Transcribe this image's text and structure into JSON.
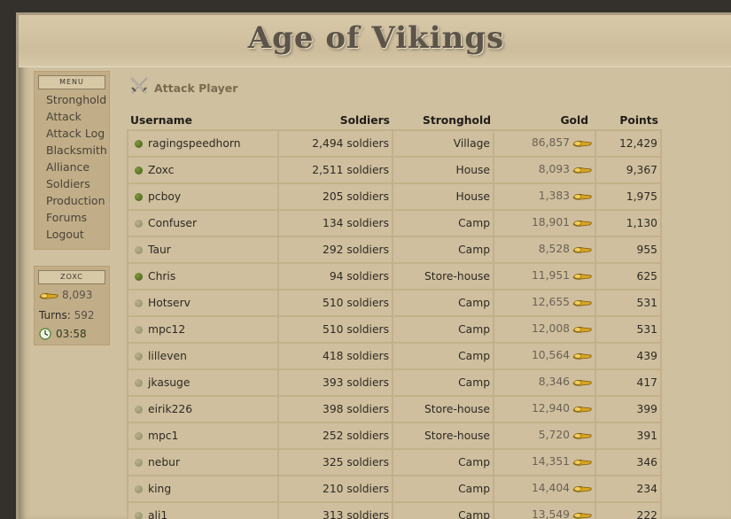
{
  "site": {
    "title": "Age of Vikings"
  },
  "menu": {
    "header": "MENU",
    "items": [
      "Stronghold",
      "Attack",
      "Attack Log",
      "Blacksmith",
      "Alliance",
      "Soldiers",
      "Production",
      "Forums",
      "Logout"
    ]
  },
  "user": {
    "header": "ZOXC",
    "gold": "8,093",
    "turns_label": "Turns:",
    "turns": "592",
    "time": "03:58"
  },
  "page": {
    "heading": "Attack Player"
  },
  "table": {
    "columns": [
      "Username",
      "Soldiers",
      "Stronghold",
      "Gold",
      "Points"
    ],
    "rows": [
      {
        "username": "ragingspeedhorn",
        "online": true,
        "soldiers": "2,494 soldiers",
        "stronghold": "Village",
        "gold": "86,857",
        "points": "12,429"
      },
      {
        "username": "Zoxc",
        "online": true,
        "soldiers": "2,511 soldiers",
        "stronghold": "House",
        "gold": "8,093",
        "points": "9,367"
      },
      {
        "username": "pcboy",
        "online": true,
        "soldiers": "205 soldiers",
        "stronghold": "House",
        "gold": "1,383",
        "points": "1,975"
      },
      {
        "username": "Confuser",
        "online": false,
        "soldiers": "134 soldiers",
        "stronghold": "Camp",
        "gold": "18,901",
        "points": "1,130"
      },
      {
        "username": "Taur",
        "online": false,
        "soldiers": "292 soldiers",
        "stronghold": "Camp",
        "gold": "8,528",
        "points": "955"
      },
      {
        "username": "Chris",
        "online": true,
        "soldiers": "94 soldiers",
        "stronghold": "Store-house",
        "gold": "11,951",
        "points": "625"
      },
      {
        "username": "Hotserv",
        "online": false,
        "soldiers": "510 soldiers",
        "stronghold": "Camp",
        "gold": "12,655",
        "points": "531"
      },
      {
        "username": "mpc12",
        "online": false,
        "soldiers": "510 soldiers",
        "stronghold": "Camp",
        "gold": "12,008",
        "points": "531"
      },
      {
        "username": "lilleven",
        "online": false,
        "soldiers": "418 soldiers",
        "stronghold": "Camp",
        "gold": "10,564",
        "points": "439"
      },
      {
        "username": "jkasuge",
        "online": false,
        "soldiers": "393 soldiers",
        "stronghold": "Camp",
        "gold": "8,346",
        "points": "417"
      },
      {
        "username": "eirik226",
        "online": false,
        "soldiers": "398 soldiers",
        "stronghold": "Store-house",
        "gold": "12,940",
        "points": "399"
      },
      {
        "username": "mpc1",
        "online": false,
        "soldiers": "252 soldiers",
        "stronghold": "Store-house",
        "gold": "5,720",
        "points": "391"
      },
      {
        "username": "nebur",
        "online": false,
        "soldiers": "325 soldiers",
        "stronghold": "Camp",
        "gold": "14,351",
        "points": "346"
      },
      {
        "username": "king",
        "online": false,
        "soldiers": "210 soldiers",
        "stronghold": "Camp",
        "gold": "14,404",
        "points": "234"
      },
      {
        "username": "ali1",
        "online": false,
        "soldiers": "313 soldiers",
        "stronghold": "Camp",
        "gold": "13,549",
        "points": "222"
      }
    ]
  },
  "colors": {
    "online": "#4f6b20",
    "offline": "#a39f78",
    "gold": "#d9a520"
  },
  "icons": {
    "gold": "gold-coins-icon",
    "clock": "clock-icon",
    "attack": "crossed-swords-icon"
  }
}
